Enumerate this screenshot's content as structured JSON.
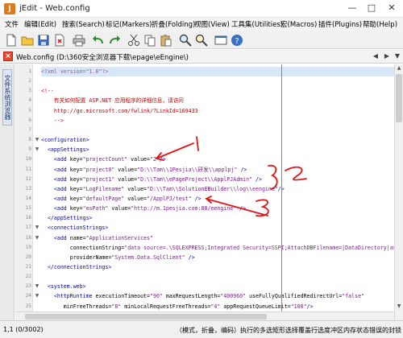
{
  "window": {
    "title": "jEdit - Web.config",
    "app_icon": "jedit-logo-icon",
    "controls": [
      "minimize-icon",
      "maximize-icon",
      "close-icon"
    ]
  },
  "menubar": {
    "items": [
      "文件",
      "编辑(Edit)",
      "搜索(Search)",
      "标记(Markers)",
      "折叠(Folding)",
      "视图(View)",
      "工具集(Utilities)",
      "宏(Macros)",
      "插件(Plugins)",
      "帮助(Help)"
    ]
  },
  "toolbar": {
    "buttons": [
      "new-file-icon",
      "open-file-icon",
      "save-icon",
      "close-file-icon",
      "print-icon",
      "undo-icon",
      "redo-icon",
      "cut-icon",
      "copy-icon",
      "paste-icon",
      "find-icon",
      "find-next-icon",
      "full-screen-icon",
      "help-icon"
    ]
  },
  "tab": {
    "file_label": "Web.config (D:\\360安全浏览器下载\\epage\\eEngine\\)"
  },
  "side_panel": {
    "tab_label": "文件系统浏览器"
  },
  "editor": {
    "lines": [
      {
        "n": "1",
        "fold": "",
        "parts": [
          [
            "pi",
            "<?xml version=\"1.0\"?>"
          ]
        ]
      },
      {
        "n": "2",
        "fold": "",
        "parts": []
      },
      {
        "n": "3",
        "fold": "",
        "parts": [
          [
            "cmt",
            "<!--"
          ]
        ]
      },
      {
        "n": "4",
        "fold": "",
        "parts": [
          [
            "cmt",
            "    有关如何配置 ASP.NET 应用程序的详细信息，请访问"
          ]
        ]
      },
      {
        "n": "5",
        "fold": "",
        "parts": [
          [
            "cmt",
            "    http://go.microsoft.com/fwlink/?LinkId=169433"
          ]
        ]
      },
      {
        "n": "6",
        "fold": "",
        "parts": [
          [
            "cmt",
            "    -->"
          ]
        ]
      },
      {
        "n": "7",
        "fold": "",
        "parts": []
      },
      {
        "n": "8",
        "fold": "▼",
        "parts": [
          [
            "tag",
            "<configuration>"
          ]
        ]
      },
      {
        "n": "9",
        "fold": "▼",
        "parts": [
          [
            "tag",
            "  <appSettings>"
          ]
        ]
      },
      {
        "n": "10",
        "fold": "",
        "parts": [
          [
            "tag",
            "    <add "
          ],
          [
            "attr",
            "key="
          ],
          [
            "val",
            "\"projectCount\""
          ],
          [
            "attr",
            " value="
          ],
          [
            "val",
            "\"2\""
          ],
          [
            "tag",
            "/>"
          ]
        ]
      },
      {
        "n": "11",
        "fold": "",
        "parts": [
          [
            "tag",
            "    <add "
          ],
          [
            "attr",
            "key="
          ],
          [
            "val",
            "\"project0\""
          ],
          [
            "attr",
            " value="
          ],
          [
            "val",
            "\"D:\\\\Tam\\\\1Pesjia\\\\研发\\\\applpj\""
          ],
          [
            "tag",
            " />"
          ]
        ]
      },
      {
        "n": "12",
        "fold": "",
        "parts": [
          [
            "tag",
            "    <add "
          ],
          [
            "attr",
            "key="
          ],
          [
            "val",
            "\"project1\""
          ],
          [
            "attr",
            " value="
          ],
          [
            "val",
            "\"D:\\\\Tam\\\\ePageProject\\\\ApplPJAdmin\""
          ],
          [
            "tag",
            " />"
          ]
        ]
      },
      {
        "n": "13",
        "fold": "",
        "parts": [
          [
            "tag",
            "    <add "
          ],
          [
            "attr",
            "key="
          ],
          [
            "val",
            "\"LogFilename\""
          ],
          [
            "attr",
            " value="
          ],
          [
            "val",
            "\"D:\\\\Tam\\\\SolutionEBuilder\\\\log\\\\eengine\""
          ],
          [
            "tag",
            "/>"
          ]
        ]
      },
      {
        "n": "14",
        "fold": "",
        "parts": [
          [
            "tag",
            "    <add "
          ],
          [
            "attr",
            "key="
          ],
          [
            "val",
            "\"defaultPage\""
          ],
          [
            "attr",
            " value="
          ],
          [
            "val",
            "\"/ApplPJ/test\""
          ],
          [
            "tag",
            " />"
          ]
        ]
      },
      {
        "n": "15",
        "fold": "",
        "parts": [
          [
            "tag",
            "    <add "
          ],
          [
            "attr",
            "key="
          ],
          [
            "val",
            "\"esPath\""
          ],
          [
            "attr",
            " value="
          ],
          [
            "val",
            "\"http://m.1pesjia.com:88/eengine\""
          ],
          [
            "tag",
            " />"
          ]
        ]
      },
      {
        "n": "16",
        "fold": "",
        "parts": [
          [
            "tag",
            "  </appSettings>"
          ]
        ]
      },
      {
        "n": "17",
        "fold": "▼",
        "parts": [
          [
            "tag",
            "  <connectionStrings>"
          ]
        ]
      },
      {
        "n": "18",
        "fold": "▼",
        "parts": [
          [
            "tag",
            "    <add "
          ],
          [
            "attr",
            "name="
          ],
          [
            "val",
            "\"ApplicationServices\""
          ]
        ]
      },
      {
        "n": "19",
        "fold": "",
        "parts": [
          [
            "attr",
            "         connectionString="
          ],
          [
            "val",
            "\"data source=.\\SQLEXPRESS;Integrated Security=SSPI;AttachDBFilename=|DataDirectory|aspnet"
          ]
        ]
      },
      {
        "n": "20",
        "fold": "",
        "parts": [
          [
            "attr",
            "         providerName="
          ],
          [
            "val",
            "\"System.Data.SqlClient\""
          ],
          [
            "tag",
            " />"
          ]
        ]
      },
      {
        "n": "21",
        "fold": "",
        "parts": [
          [
            "tag",
            "  </connectionStrings>"
          ]
        ]
      },
      {
        "n": "22",
        "fold": "",
        "parts": []
      },
      {
        "n": "23",
        "fold": "▼",
        "parts": [
          [
            "tag",
            "  <system.web>"
          ]
        ]
      },
      {
        "n": "24",
        "fold": "▼",
        "parts": [
          [
            "tag",
            "    <httpRuntime "
          ],
          [
            "attr",
            "executionTimeout="
          ],
          [
            "val",
            "\"90\""
          ],
          [
            "attr",
            " maxRequestLength="
          ],
          [
            "val",
            "\"400960\""
          ],
          [
            "attr",
            " useFullyQualifiedRedirectUrl="
          ],
          [
            "val",
            "\"false\""
          ]
        ]
      },
      {
        "n": "25",
        "fold": "",
        "parts": [
          [
            "attr",
            "       minFreeThreads="
          ],
          [
            "val",
            "\"8\""
          ],
          [
            "attr",
            " minLocalRequestFreeThreads="
          ],
          [
            "val",
            "\"4\""
          ],
          [
            "attr",
            " appRequestQueueLimit="
          ],
          [
            "val",
            "\"100\""
          ],
          [
            "tag",
            "/>"
          ]
        ]
      }
    ]
  },
  "statusbar": {
    "position": "1,1 (0/3002)",
    "message": "（模式，折叠，编码）执行的多选矩形选择覆盖行选度冲区内存状态错误的封锁"
  },
  "colors": {
    "tag": "#0000cc",
    "value": "#7a1e8c",
    "comment": "#c00000",
    "current_line": "#d8e7f8",
    "wrap_guide": "#7b7bf4",
    "annotation": "#e01515"
  }
}
